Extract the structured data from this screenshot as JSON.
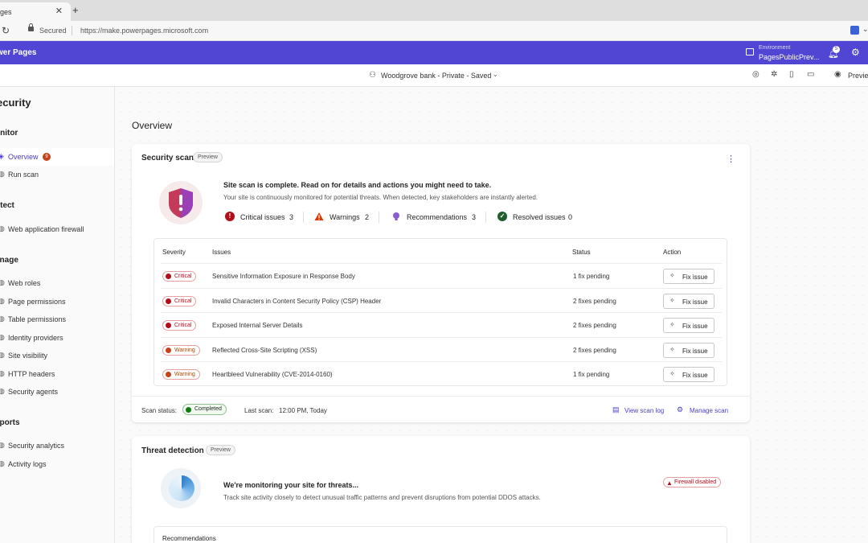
{
  "browser": {
    "tab_title": "ges",
    "tab_close": "✕",
    "new_tab": "+",
    "secured_label": "Secured",
    "url": "https://make.powerpages.microsoft.com"
  },
  "app": {
    "title": "wer Pages",
    "environment_label": "Environment",
    "environment_value": "PagesPublicPrev...",
    "notification_count": "5"
  },
  "command_bar": {
    "site": "Woodgrove bank - Private - Saved",
    "preview_label": "Preview"
  },
  "sidebar": {
    "title": "ecurity",
    "groups": {
      "monitor": "onitor",
      "protect": "otect",
      "manage": "anage",
      "reports": "eports"
    },
    "items": {
      "overview": {
        "label": "Overview",
        "badge": "9"
      },
      "run_scan": {
        "label": "Run scan"
      },
      "waf": {
        "label": "Web application firewall"
      },
      "web_roles": {
        "label": "Web roles"
      },
      "page_permissions": {
        "label": "Page permissions"
      },
      "table_permissions": {
        "label": "Table permissions"
      },
      "identity_providers": {
        "label": "Identity providers"
      },
      "site_visibility": {
        "label": "Site visibility"
      },
      "http_headers": {
        "label": "HTTP headers"
      },
      "security_agents": {
        "label": "Security agents"
      },
      "security_analytics": {
        "label": "Security analytics"
      },
      "activity_logs": {
        "label": "Activity logs"
      }
    }
  },
  "main": {
    "page_title": "Overview",
    "scan_card": {
      "title": "Security scan",
      "preview_pill": "Preview",
      "more": "⋮",
      "headline": "Site scan is complete. Read on for details and actions you might need to take.",
      "subline": "Your site is continuously monitored for potential threats. When detected, key stakeholders are instantly alerted.",
      "stats": {
        "critical": {
          "label": "Critical issues",
          "value": "3"
        },
        "warnings": {
          "label": "Warnings",
          "value": "2"
        },
        "recommendations": {
          "label": "Recommendations",
          "value": "3"
        },
        "resolved": {
          "label": "Resolved issues",
          "value": "0"
        }
      },
      "columns": {
        "severity": "Severity",
        "issues": "Issues",
        "status": "Status",
        "action": "Action"
      },
      "rows": [
        {
          "severity": "Critical",
          "issue": "Sensitive Information Exposure in Response Body",
          "status": "1 fix pending",
          "action": "Fix issue"
        },
        {
          "severity": "Critical",
          "issue": "Invalid Characters in Content Security Policy (CSP) Header",
          "status": "2 fixes pending",
          "action": "Fix issue"
        },
        {
          "severity": "Critical",
          "issue": "Exposed Internal Server Details",
          "status": "2 fixes pending",
          "action": "Fix issue"
        },
        {
          "severity": "Warning",
          "issue": "Reflected Cross-Site Scripting (XSS)",
          "status": "2 fixes pending",
          "action": "Fix issue"
        },
        {
          "severity": "Warning",
          "issue": "Heartbleed Vulnerability (CVE-2014-0160)",
          "status": "1 fix pending",
          "action": "Fix issue"
        }
      ],
      "footer": {
        "scan_status_label": "Scan status:",
        "scan_status_value": "Completed",
        "last_scan_label": "Last scan:",
        "last_scan_value": "12:00 PM, Today",
        "view_log": "View scan log",
        "manage_scan": "Manage scan"
      }
    },
    "threat_card": {
      "title": "Threat detection",
      "preview_pill": "Preview",
      "headline": "We're monitoring your site for threats...",
      "subline": "Track site activity closely to detect unusual traffic patterns and prevent disruptions from potential DDOS attacks.",
      "firewall_badge": "Firewall disabled",
      "recommendations_title": "Recommendations"
    }
  },
  "colors": {
    "brand": "#5046d3",
    "critical": "#b10e1c",
    "warning": "#d83b01",
    "recommendation": "#8a5cd6",
    "resolved": "#107c10"
  }
}
